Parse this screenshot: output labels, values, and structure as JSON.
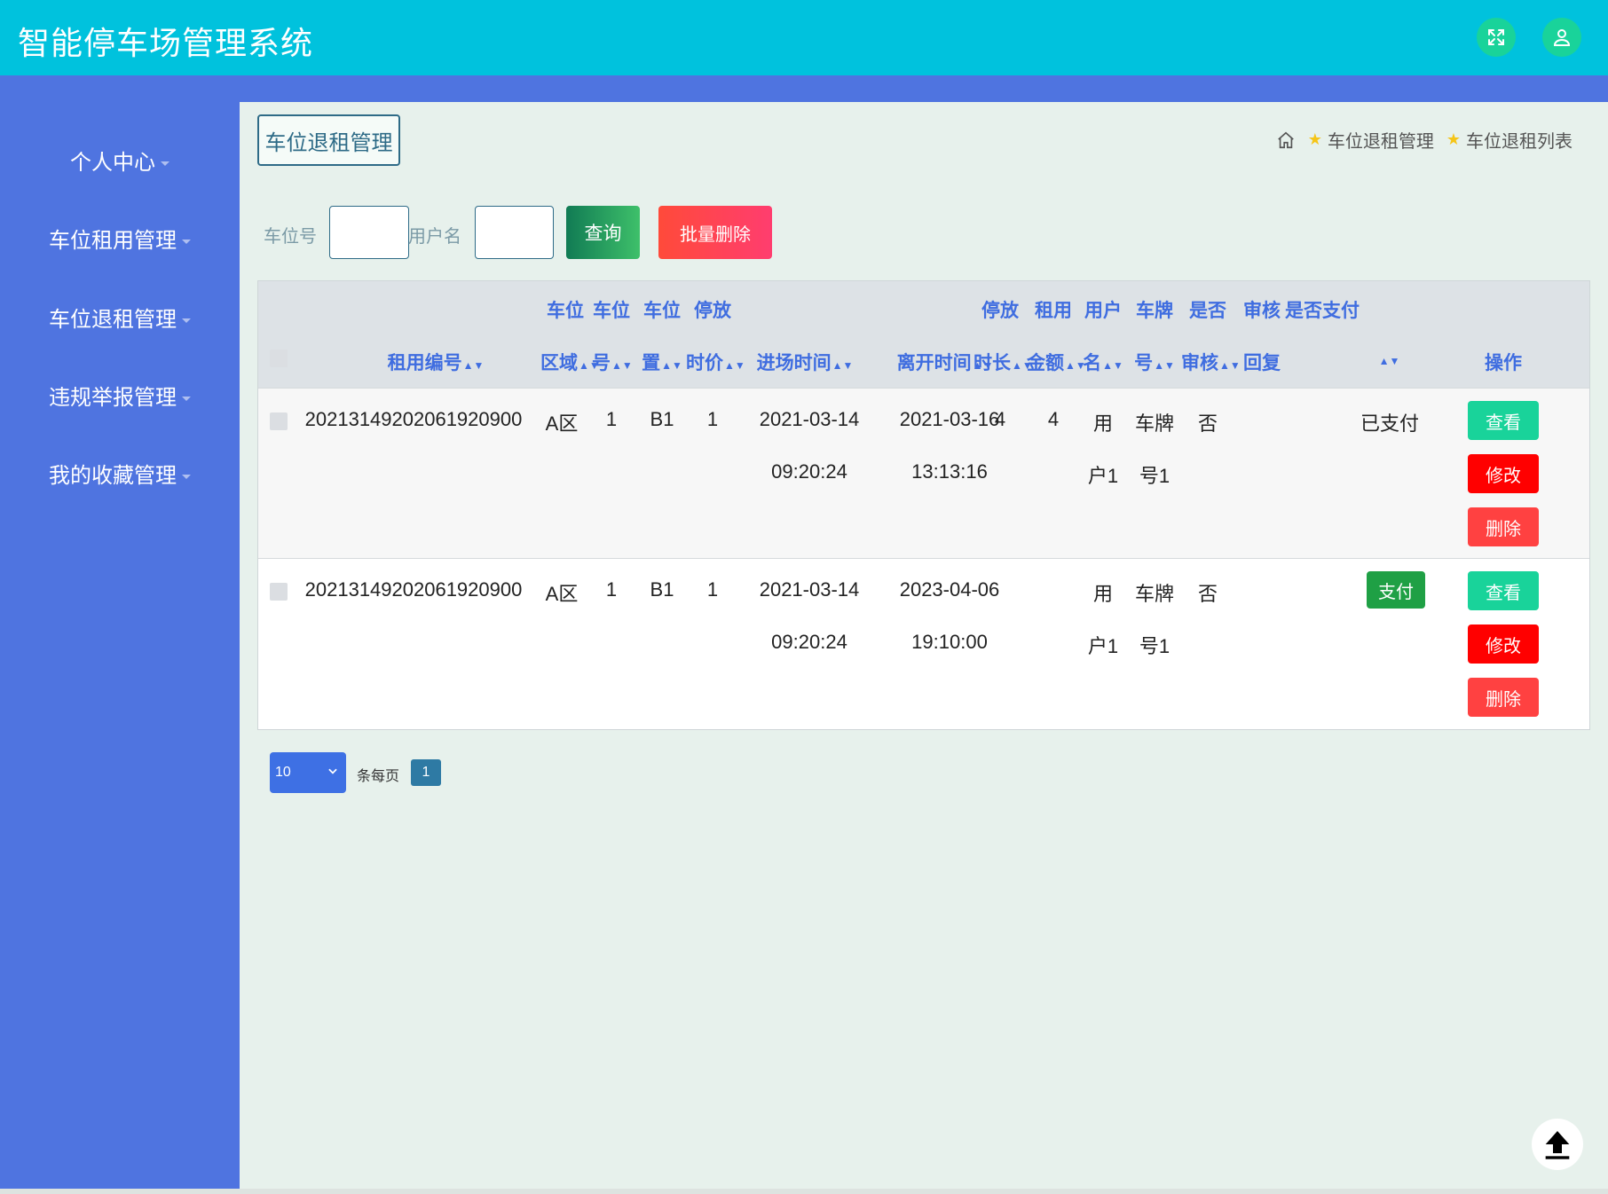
{
  "app": {
    "title": "智能停车场管理系统"
  },
  "header": {
    "expand_icon": "expand-arrows-icon",
    "user_icon": "user-icon"
  },
  "sidebar": {
    "items": [
      {
        "label": "个人中心"
      },
      {
        "label": "车位租用管理"
      },
      {
        "label": "车位退租管理"
      },
      {
        "label": "违规举报管理"
      },
      {
        "label": "我的收藏管理"
      }
    ]
  },
  "page": {
    "title": "车位退租管理",
    "breadcrumb": [
      "车位退租管理",
      "车位退租列表"
    ]
  },
  "search": {
    "field1_label": "车位号",
    "field1_value": "",
    "field2_label": "用户名",
    "field2_value": "",
    "query_button": "查询",
    "batch_delete_button": "批量删除"
  },
  "table": {
    "headers": {
      "rent_no": "租用编号",
      "area_1": "车位",
      "area_2": "区域",
      "no_1": "车位",
      "no_2": "号",
      "pos_1": "车位",
      "pos_2": "置",
      "price_1": "停放",
      "price_2": "时价",
      "enter_time": "进场时间",
      "leave_time": "离开时间",
      "duration_1": "停放",
      "duration_2": "时长",
      "amount_1": "租用",
      "amount_2": "金额",
      "user_1": "用户",
      "user_2": "名",
      "plate_1": "车牌",
      "plate_2": "号",
      "audit_1": "是否",
      "audit_2": "审核",
      "reply_1": "审核",
      "reply_2": "回复",
      "paid": "是否支付",
      "ops": "操作"
    },
    "rows": [
      {
        "rent_no": "20213149202061920900",
        "area": "A区",
        "no": "1",
        "pos": "B1",
        "price": "1",
        "enter_date": "2021-03-14",
        "enter_time": "09:20:24",
        "leave_date": "2021-03-16",
        "leave_time": "13:13:16",
        "duration": "4",
        "amount": "4",
        "user_1": "用",
        "user_2": "户1",
        "plate_1": "车牌",
        "plate_2": "号1",
        "audited": "否",
        "paid": "已支付"
      },
      {
        "rent_no": "20213149202061920900",
        "area": "A区",
        "no": "1",
        "pos": "B1",
        "price": "1",
        "enter_date": "2021-03-14",
        "enter_time": "09:20:24",
        "leave_date": "2023-04-06",
        "leave_time": "19:10:00",
        "duration": "",
        "amount": "",
        "user_1": "用",
        "user_2": "户1",
        "plate_1": "车牌",
        "plate_2": "号1",
        "audited": "否",
        "pay_button": "支付"
      }
    ],
    "actions": {
      "view": "查看",
      "edit": "修改",
      "delete": "删除"
    }
  },
  "pager": {
    "page_size": "10",
    "per_page_label": "条每页",
    "current_page": "1"
  },
  "colors": {
    "header": "#00c2dd",
    "sidebar": "#4f74e0",
    "main_bg": "#e7f1ec",
    "accent_green": "#19d39a",
    "danger": "#ff0000"
  }
}
